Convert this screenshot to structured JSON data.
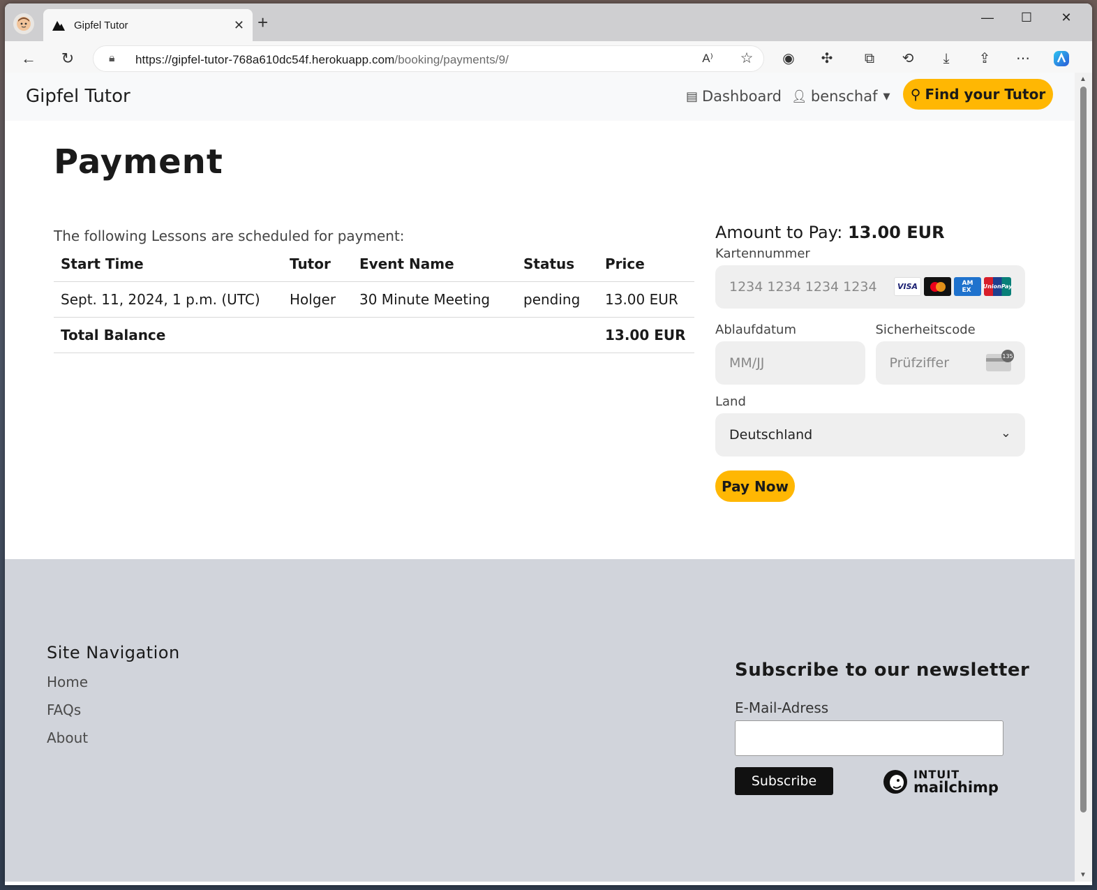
{
  "browser": {
    "tab_title": "Gipfel Tutor",
    "url_domain": "https://gipfel-tutor-768a610dc54f.herokuapp.com",
    "url_path": "/booking/payments/9/"
  },
  "navbar": {
    "brand": "Gipfel Tutor",
    "dashboard_label": "Dashboard",
    "user_label": "benschaf",
    "find_tutor_label": "Find your Tutor"
  },
  "main": {
    "title": "Payment",
    "intro": "The following Lessons are scheduled for payment:",
    "table": {
      "headers": [
        "Start Time",
        "Tutor",
        "Event Name",
        "Status",
        "Price"
      ],
      "rows": [
        [
          "Sept. 11, 2024, 1 p.m. (UTC)",
          "Holger",
          "30 Minute Meeting",
          "pending",
          "13.00 EUR"
        ]
      ],
      "total_label": "Total Balance",
      "total_value": "13.00 EUR"
    }
  },
  "payment": {
    "amount_label": "Amount to Pay:",
    "amount_value": "13.00 EUR",
    "card_number_label": "Kartennummer",
    "card_number_placeholder": "1234 1234 1234 1234",
    "expiry_label": "Ablaufdatum",
    "expiry_placeholder": "MM/JJ",
    "cvc_label": "Sicherheitscode",
    "cvc_placeholder": "Prüfziffer",
    "country_label": "Land",
    "country_value": "Deutschland",
    "pay_button": "Pay Now",
    "card_brands": [
      "VISA",
      "MC",
      "AMEX",
      "UnionPay"
    ],
    "cvc_badge": "135"
  },
  "footer": {
    "nav_title": "Site Navigation",
    "links": [
      "Home",
      "FAQs",
      "About"
    ],
    "newsletter_title": "Subscribe to our newsletter",
    "email_label": "E-Mail-Adress",
    "subscribe_button": "Subscribe",
    "mailchimp_line1": "INTUIT",
    "mailchimp_line2": "mailchimp"
  },
  "colors": {
    "accent": "#ffb703",
    "footer_bg": "#d1d4db"
  }
}
